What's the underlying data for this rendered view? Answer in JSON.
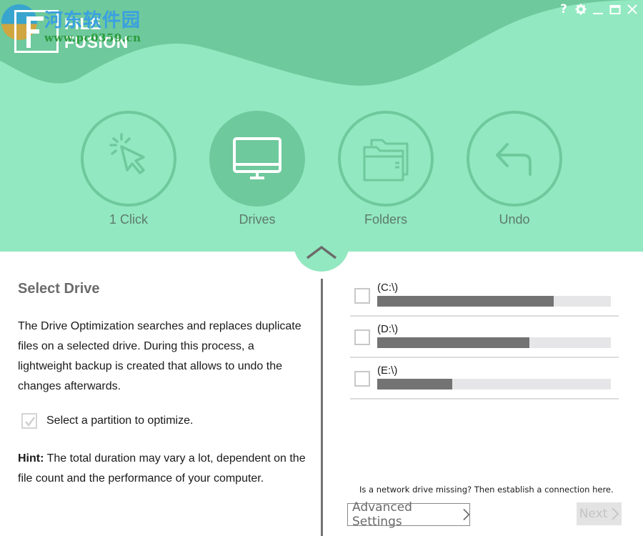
{
  "app": {
    "name_line1": "FILE",
    "name_line2": "FUSION",
    "watermark_cn": "河东软件园",
    "watermark_url": "www.pc0359.cn"
  },
  "window_controls": [
    {
      "name": "help",
      "icon": "question-icon"
    },
    {
      "name": "settings",
      "icon": "gear-icon"
    },
    {
      "name": "minimize",
      "icon": "minimize-icon"
    },
    {
      "name": "maximize",
      "icon": "maximize-icon"
    },
    {
      "name": "close",
      "icon": "close-icon"
    }
  ],
  "nav": {
    "items": [
      {
        "label": "1 Click",
        "icon": "cursor-click-icon",
        "active": false
      },
      {
        "label": "Drives",
        "icon": "monitor-icon",
        "active": true
      },
      {
        "label": "Folders",
        "icon": "folders-icon",
        "active": false
      },
      {
        "label": "Undo",
        "icon": "undo-arrow-icon",
        "active": false
      }
    ]
  },
  "left": {
    "title": "Select Drive",
    "description": "The Drive Optimization searches and replaces duplicate files on a selected drive. During this process, a lightweight backup is created that allows to undo the changes afterwards.",
    "partition_label": "Select a partition to optimize.",
    "partition_checked": true,
    "hint_label": "Hint:",
    "hint_text": " The total duration may vary a lot, dependent on the file count and the performance of your computer."
  },
  "drives": [
    {
      "label": "(C:\\)",
      "checked": false,
      "used_percent": 75.5
    },
    {
      "label": "(D:\\)",
      "checked": false,
      "used_percent": 65
    },
    {
      "label": "(E:\\)",
      "checked": false,
      "used_percent": 32
    }
  ],
  "footer": {
    "network_text": "Is a network drive missing? Then establish a connection here.",
    "advanced_label": "Advanced Settings",
    "next_label": "Next",
    "next_enabled": false
  },
  "colors": {
    "header_light": "#92e8c0",
    "header_dark": "#6ec99d",
    "bar_fill": "#737373",
    "bar_bg": "#e6e6e8"
  }
}
